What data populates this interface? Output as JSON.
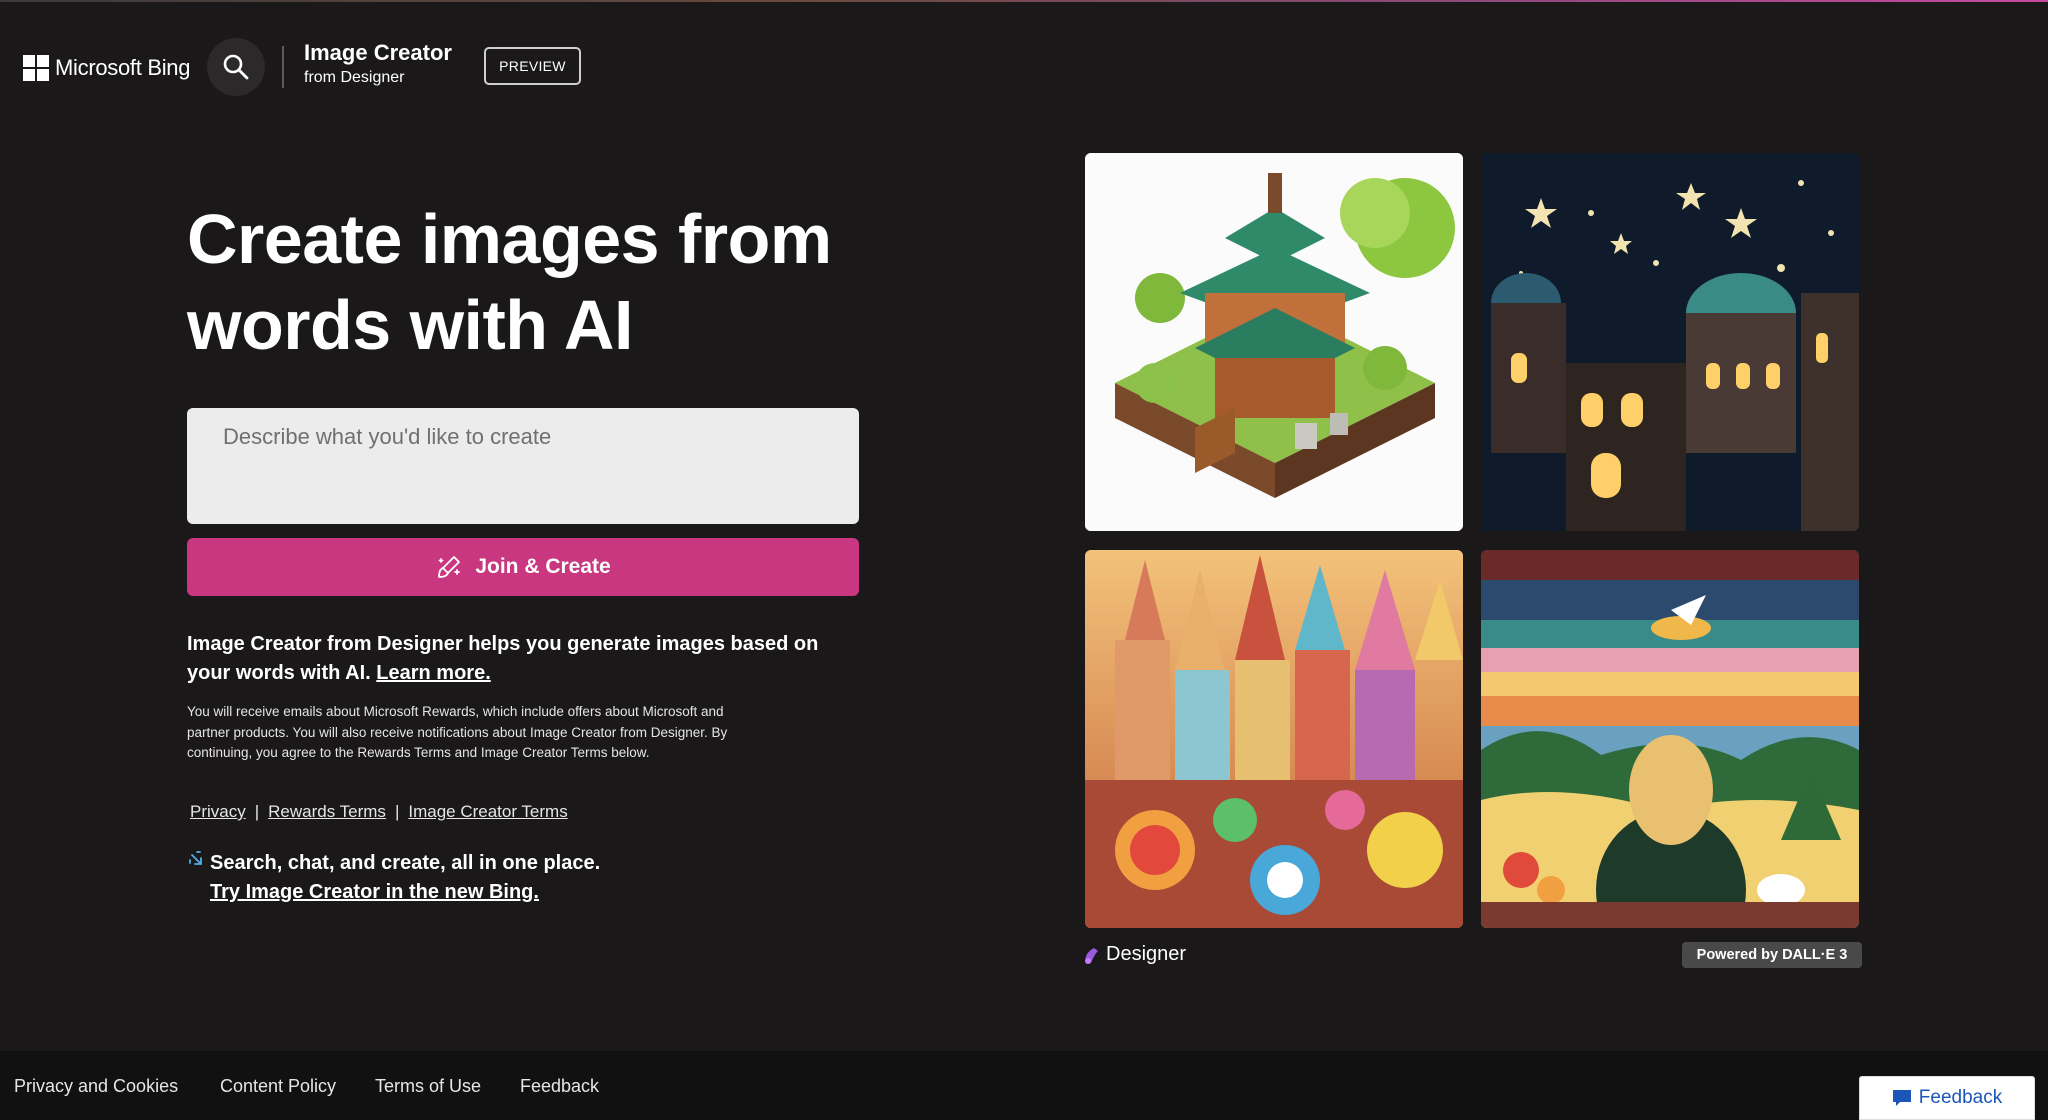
{
  "header": {
    "brand": "Microsoft Bing",
    "product_title": "Image Creator",
    "product_subtitle": "from Designer",
    "badge": "PREVIEW",
    "search_icon": "search-icon"
  },
  "hero": {
    "title": "Create images from words with AI",
    "prompt_placeholder": "Describe what you'd like to create",
    "prompt_value": "",
    "create_button": "Join & Create",
    "create_icon": "brush-sparkle-icon"
  },
  "description": {
    "text": "Image Creator from Designer helps you generate images based on your words with AI.",
    "link": "Learn more."
  },
  "fine_print": "You will receive emails about Microsoft Rewards, which include offers about Microsoft and partner products. You will also receive notifications about Image Creator from Designer. By continuing, you agree to the Rewards Terms and Image Creator Terms below.",
  "legal_links": {
    "privacy": "Privacy",
    "rewards_terms": "Rewards Terms",
    "image_creator_terms": "Image Creator Terms",
    "separator": "|"
  },
  "promo": {
    "line1": "Search, chat, and create, all in one place.",
    "link": "Try Image Creator in the new Bing."
  },
  "gallery": {
    "designer_label": "Designer",
    "powered_by": "Powered by DALL·E 3"
  },
  "footer": {
    "links": [
      "Privacy and Cookies",
      "Content Policy",
      "Terms of Use",
      "Feedback"
    ],
    "feedback_button": "Feedback"
  },
  "colors": {
    "background": "#1a1818",
    "accent": "#c8377f",
    "footer": "#121111",
    "feedback_text": "#1b56b8"
  }
}
